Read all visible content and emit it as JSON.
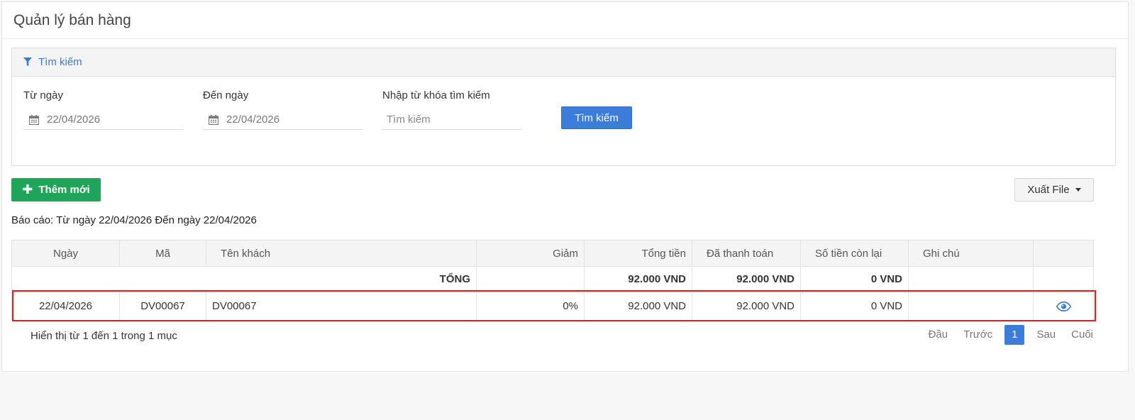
{
  "page": {
    "title": "Quản lý bán hàng"
  },
  "search": {
    "header": "Tìm kiếm",
    "from_label": "Từ ngày",
    "from_value": "22/04/2026",
    "to_label": "Đến ngày",
    "to_value": "22/04/2026",
    "keyword_label": "Nhập từ khóa tìm kiếm",
    "keyword_placeholder": "Tìm kiếm",
    "keyword_value": "",
    "button": "Tìm kiếm"
  },
  "actions": {
    "add_label": "Thêm mới",
    "export_label": "Xuất File"
  },
  "report": {
    "text": "Báo cáo: Từ ngày 22/04/2026 Đến ngày 22/04/2026"
  },
  "table": {
    "headers": [
      "Ngày",
      "Mã",
      "Tên khách",
      "Giảm",
      "Tổng tiền",
      "Đã thanh toán",
      "Số tiền còn lại",
      "Ghi chú",
      ""
    ],
    "total": {
      "label": "TỔNG",
      "tong_tien": "92.000 VND",
      "da_thanh_toan": "92.000 VND",
      "con_lai": "0 VND"
    },
    "rows": [
      {
        "ngay": "22/04/2026",
        "ma": "DV00067",
        "ten_khach": "DV00067",
        "giam": "0%",
        "tong_tien": "92.000 VND",
        "da_thanh_toan": "92.000 VND",
        "con_lai": "0 VND",
        "ghi_chu": "",
        "action_icon": "eye-icon"
      }
    ]
  },
  "footer": {
    "info": "Hiển thị từ 1 đến 1 trong 1 mục",
    "pager": {
      "first": "Đầu",
      "prev": "Trước",
      "current": "1",
      "next": "Sau",
      "last": "Cuối"
    }
  },
  "colors": {
    "primary": "#3b7dd8",
    "success": "#1fa55a",
    "highlight": "#e02020"
  }
}
